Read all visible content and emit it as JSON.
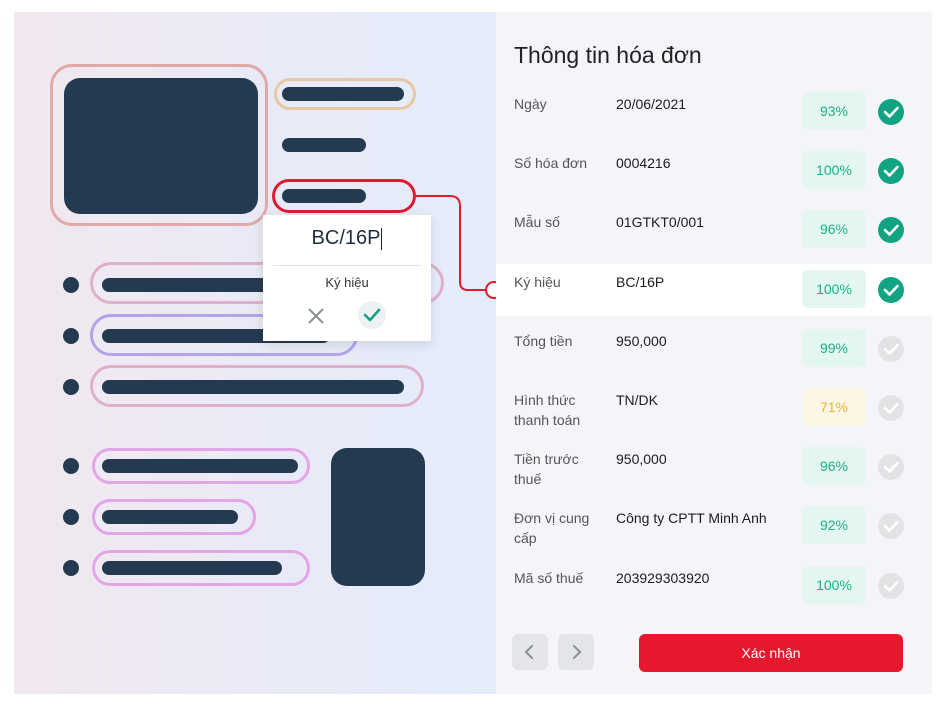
{
  "popup": {
    "value": "BC/16P",
    "label": "Ký hiệu",
    "cancel_icon": "close-icon",
    "confirm_icon": "check-icon"
  },
  "panel": {
    "title": "Thông tin hóa đơn",
    "fields": [
      {
        "label": "Ngày",
        "value": "20/06/2021",
        "confidence": "93%",
        "verified": true
      },
      {
        "label": "Số hóa đơn",
        "value": "0004216",
        "confidence": "100%",
        "verified": true
      },
      {
        "label": "Mẫu số",
        "value": "01GTKT0/001",
        "confidence": "96%",
        "verified": true
      },
      {
        "label": "Ký hiệu",
        "value": "BC/16P",
        "confidence": "100%",
        "verified": true
      },
      {
        "label": "Tổng tiền",
        "value": "950,000",
        "confidence": "99%",
        "verified": false
      },
      {
        "label": "Hình thức thanh toán",
        "value": "TN/DK",
        "confidence": "71%",
        "verified": false
      },
      {
        "label": "Tiền trước thuế",
        "value": "950,000",
        "confidence": "96%",
        "verified": false
      },
      {
        "label": "Đơn vị cung cấp",
        "value": "Công ty CPTT Minh Anh",
        "confidence": "92%",
        "verified": false
      },
      {
        "label": "Mã số thuế",
        "value": "203929303920",
        "confidence": "100%",
        "verified": false
      }
    ],
    "prev_icon": "chevron-left-icon",
    "next_icon": "chevron-right-icon",
    "confirm_label": "Xác nhận"
  },
  "colors": {
    "accent_red": "#e5182d",
    "verified_green": "#12a382",
    "confidence_green": "#19b28a",
    "confidence_warn": "#e8b33a",
    "navy": "#243a51"
  }
}
